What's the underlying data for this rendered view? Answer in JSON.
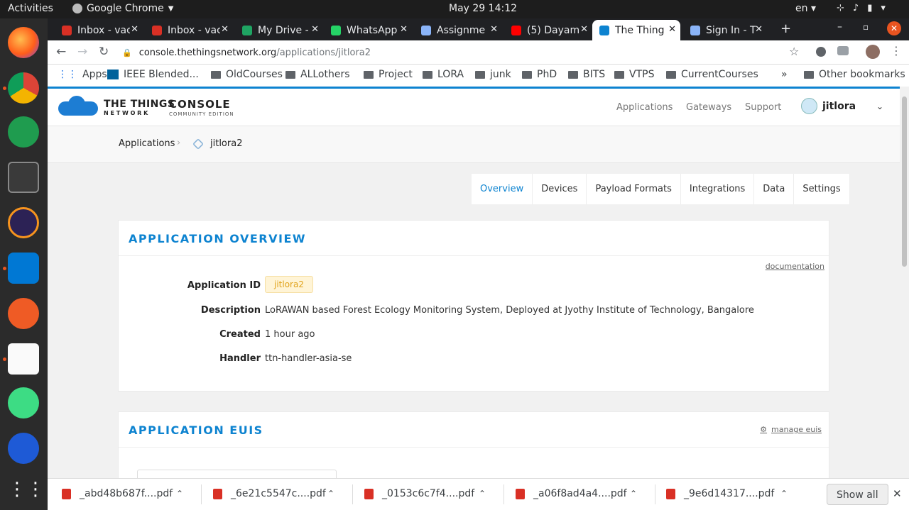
{
  "os": {
    "activities": "Activities",
    "app": "Google Chrome",
    "clock": "May 29  14:12",
    "lang": "en"
  },
  "tabs": [
    {
      "title": "Inbox - vac",
      "icon": "gmail-icon",
      "color": "#d93025"
    },
    {
      "title": "Inbox - vac",
      "icon": "gmail-icon",
      "color": "#d93025"
    },
    {
      "title": "My Drive -",
      "icon": "drive-icon",
      "color": "#1fa463"
    },
    {
      "title": "WhatsApp",
      "icon": "whatsapp-icon",
      "color": "#25d366"
    },
    {
      "title": "Assignme",
      "icon": "link-icon",
      "color": "#8ab4f8"
    },
    {
      "title": "(5) Dayam",
      "icon": "youtube-icon",
      "color": "#ff0000"
    },
    {
      "title": "The Thing",
      "icon": "ttn-icon",
      "color": "#0d83d0"
    },
    {
      "title": "Sign In - T",
      "icon": "chat-icon",
      "color": "#8ab4f8"
    }
  ],
  "address": {
    "host": "console.thethingsnetwork.org",
    "path": "/applications/jitlora2"
  },
  "bookmarks": [
    "Apps",
    "IEEE Blended...",
    "OldCourses",
    "ALLothers",
    "Project",
    "LORA",
    "junk",
    "PhD",
    "BITS",
    "VTPS",
    "CurrentCourses",
    "Other bookmarks"
  ],
  "brand": {
    "line1": "THE THINGS",
    "line2": "N E T W O R K",
    "console": "CONSOLE",
    "edition": "COMMUNITY EDITION"
  },
  "topnav": {
    "applications": "Applications",
    "gateways": "Gateways",
    "support": "Support",
    "user": "jitlora"
  },
  "breadcrumb": {
    "root": "Applications",
    "current": "jitlora2"
  },
  "subtabs": [
    "Overview",
    "Devices",
    "Payload Formats",
    "Integrations",
    "Data",
    "Settings"
  ],
  "overview": {
    "title": "APPLICATION OVERVIEW",
    "doc_link": "documentation",
    "fields": {
      "id_label": "Application ID",
      "id": "jitlora2",
      "desc_label": "Description",
      "desc": "LoRAWAN based Forest Ecology Monitoring System, Deployed at Jyothy Institute of Technology, Bangalore",
      "created_label": "Created",
      "created": "1 hour ago",
      "handler_label": "Handler",
      "handler": "ttn-handler-asia-se"
    }
  },
  "euis": {
    "title": "APPLICATION EUIS",
    "manage": "manage euis"
  },
  "downloads": [
    "_abd48b687f....pdf",
    "_6e21c5547c....pdf",
    "_0153c6c7f4....pdf",
    "_a06f8ad4a4....pdf",
    "_9e6d14317....pdf"
  ],
  "show_all": "Show all"
}
